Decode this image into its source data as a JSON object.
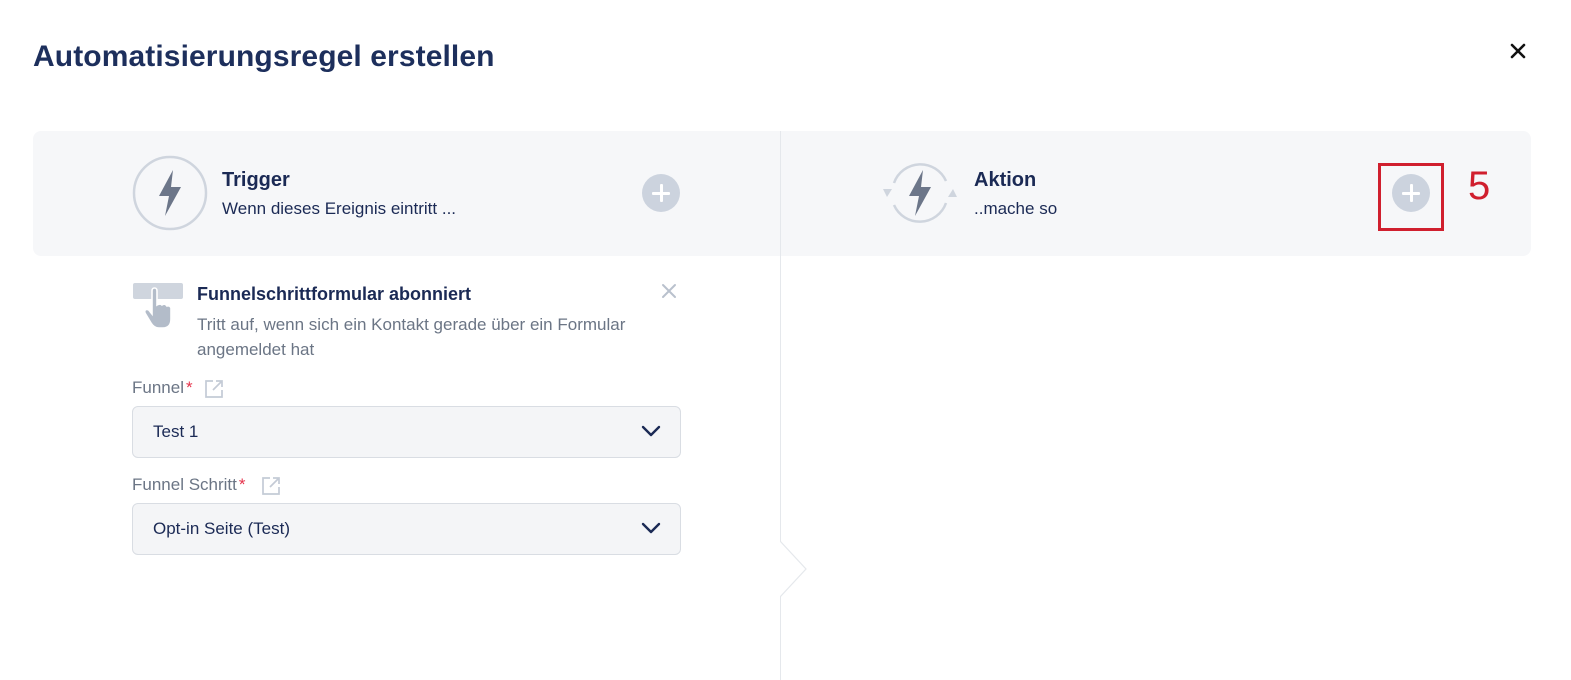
{
  "dialog": {
    "title": "Automatisierungsregel erstellen"
  },
  "trigger_section": {
    "title": "Trigger",
    "subtitle": "Wenn dieses Ereignis eintritt ..."
  },
  "action_section": {
    "title": "Aktion",
    "subtitle": "..mache so"
  },
  "annotation": {
    "step_number": "5",
    "color": "#d01f2e"
  },
  "selected_trigger": {
    "icon": "hand-pointer-form-icon",
    "name": "Funnelschrittformular abonniert",
    "description": "Tritt auf, wenn sich ein Kontakt gerade über ein Formular angemeldet hat"
  },
  "fields": {
    "funnel": {
      "label": "Funnel",
      "required_mark": "*",
      "value": "Test 1"
    },
    "funnel_step": {
      "label": "Funnel Schritt",
      "required_mark": "*",
      "value": "Opt-in Seite (Test)"
    }
  },
  "colors": {
    "primary_text": "#1b2a55",
    "muted_text": "#6b7585",
    "panel_bg": "#f6f7f9",
    "icon_gray": "#6c7689",
    "plus_bg": "#ccd3de",
    "required": "#e5334b"
  }
}
